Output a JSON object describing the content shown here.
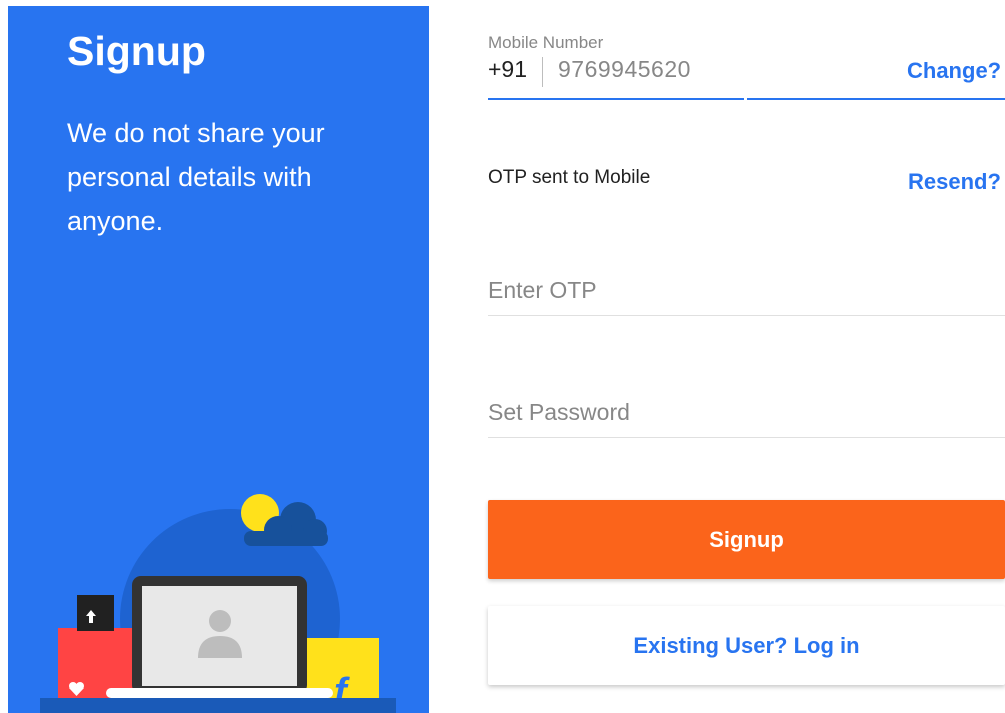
{
  "left_panel": {
    "title": "Signup",
    "subtitle": "We do not share your personal details with anyone.",
    "background_color": "#2874f0"
  },
  "form": {
    "mobile": {
      "label": "Mobile Number",
      "country_code": "+91",
      "value": "9769945620",
      "change_link": "Change?"
    },
    "otp_message": "OTP sent to Mobile",
    "resend_link": "Resend?",
    "otp_field": {
      "placeholder": "Enter OTP"
    },
    "password_field": {
      "placeholder": "Set Password"
    },
    "signup_button": "Signup",
    "login_button": "Existing User? Log in"
  },
  "colors": {
    "accent": "#2874f0",
    "signup_button": "#fb641b"
  }
}
